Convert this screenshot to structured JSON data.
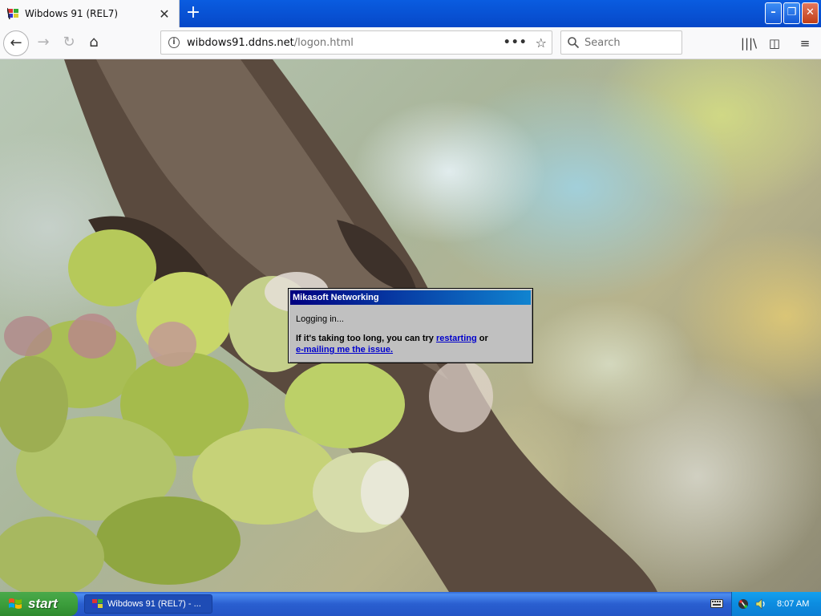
{
  "browser": {
    "tab": {
      "title": "Wibdows 91 (REL7)",
      "close_glyph": "✕"
    },
    "new_tab_glyph": "+",
    "window_controls": {
      "minimize": "–",
      "maximize": "❐",
      "close": "✕"
    }
  },
  "toolbar": {
    "back_glyph": "←",
    "forward_glyph": "→",
    "reload_glyph": "↻",
    "home_glyph": "⌂",
    "url": {
      "host": "wibdows91.ddns.net",
      "path": "/logon.html"
    },
    "page_actions_glyph": "•••",
    "bookmark_glyph": "☆",
    "search": {
      "placeholder": "Search"
    },
    "library_glyph": "|||\\",
    "sidebar_glyph": "◫",
    "menu_glyph": "≡"
  },
  "dialog": {
    "title": "Mikasoft Networking",
    "status": "Logging in...",
    "message_before": "If it's taking too long, you can try ",
    "link_restart": "restarting",
    "message_middle": " or",
    "link_email": "e-mailing me the issue."
  },
  "taskbar": {
    "start_label": "start",
    "task_item_label": "Wibdows 91 (REL7) - ...",
    "clock": "8:07 AM"
  },
  "colors": {
    "titlebar_blue": "#0648c8",
    "dialog_title_start": "#000080",
    "dialog_title_end": "#1084d0",
    "taskbar_blue": "#2a5fd0",
    "start_green": "#3c9e3c",
    "link_blue": "#0000cc"
  }
}
